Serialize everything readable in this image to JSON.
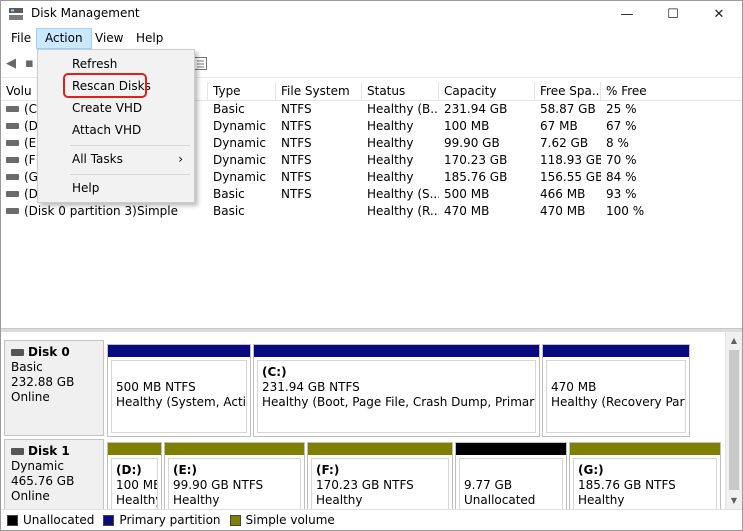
{
  "window": {
    "title": "Disk Management",
    "controls": {
      "minimize": "—",
      "maximize": "☐",
      "close": "✕"
    }
  },
  "menubar": [
    "File",
    "Action",
    "View",
    "Help"
  ],
  "action_menu": {
    "items": [
      "Refresh",
      "Rescan Disks",
      "Create VHD",
      "Attach VHD",
      "All Tasks",
      "Help"
    ],
    "submenu_arrow": "›",
    "highlighted": "Rescan Disks",
    "highlight_color": "#e0201a"
  },
  "volume_list": {
    "headers": [
      "Volu",
      "Type",
      "File System",
      "Status",
      "Capacity",
      "Free Spa...",
      "% Free"
    ],
    "rows": [
      {
        "volume": "(C",
        "layout": "",
        "type": "Basic",
        "fs": "NTFS",
        "status": "Healthy (B...",
        "capacity": "231.94 GB",
        "free": "58.87 GB",
        "pct": "25 %"
      },
      {
        "volume": "(D",
        "layout": "",
        "type": "Dynamic",
        "fs": "NTFS",
        "status": "Healthy",
        "capacity": "100 MB",
        "free": "67 MB",
        "pct": "67 %"
      },
      {
        "volume": "(E",
        "layout": "",
        "type": "Dynamic",
        "fs": "NTFS",
        "status": "Healthy",
        "capacity": "99.90 GB",
        "free": "7.62 GB",
        "pct": "8 %"
      },
      {
        "volume": "(F",
        "layout": "",
        "type": "Dynamic",
        "fs": "NTFS",
        "status": "Healthy",
        "capacity": "170.23 GB",
        "free": "118.93 GB",
        "pct": "70 %"
      },
      {
        "volume": "(G",
        "layout": "",
        "type": "Dynamic",
        "fs": "NTFS",
        "status": "Healthy",
        "capacity": "185.76 GB",
        "free": "156.55 GB",
        "pct": "84 %"
      },
      {
        "volume": "(Di",
        "layout": "",
        "type": "Basic",
        "fs": "NTFS",
        "status": "Healthy (S...",
        "capacity": "500 MB",
        "free": "466 MB",
        "pct": "93 %"
      },
      {
        "volume": "(Disk 0 partition 3)",
        "layout": "Simple",
        "type": "Basic",
        "fs": "",
        "status": "Healthy (R...",
        "capacity": "470 MB",
        "free": "470 MB",
        "pct": "100 %"
      }
    ]
  },
  "disks": [
    {
      "name": "Disk 0",
      "type": "Basic",
      "size": "232.88 GB",
      "state": "Online",
      "partitions": [
        {
          "label": "",
          "line1": "500 MB NTFS",
          "line2": "Healthy (System, Active,",
          "kind": "primary"
        },
        {
          "label": "(C:)",
          "line1": "231.94 GB NTFS",
          "line2": "Healthy (Boot, Page File, Crash Dump, Primary Partit",
          "kind": "primary"
        },
        {
          "label": "",
          "line1": "470 MB",
          "line2": "Healthy (Recovery Partiti",
          "kind": "primary"
        }
      ]
    },
    {
      "name": "Disk 1",
      "type": "Dynamic",
      "size": "465.76 GB",
      "state": "Online",
      "partitions": [
        {
          "label": "(D:)",
          "line1": "100 MB",
          "line2": "Healthy",
          "kind": "simple"
        },
        {
          "label": "(E:)",
          "line1": "99.90 GB NTFS",
          "line2": "Healthy",
          "kind": "simple"
        },
        {
          "label": "(F:)",
          "line1": "170.23 GB NTFS",
          "line2": "Healthy",
          "kind": "simple"
        },
        {
          "label": "",
          "line1": "9.77 GB",
          "line2": "Unallocated",
          "kind": "unallocated"
        },
        {
          "label": "(G:)",
          "line1": "185.76 GB NTFS",
          "line2": "Healthy",
          "kind": "simple"
        }
      ]
    }
  ],
  "legend": [
    {
      "label": "Unallocated",
      "color": "#000000"
    },
    {
      "label": "Primary partition",
      "color": "#0a0a80"
    },
    {
      "label": "Simple volume",
      "color": "#808000"
    }
  ],
  "colors": {
    "primary": "#0a0a80",
    "simple": "#808000",
    "unallocated": "#000000",
    "menu_active_bg": "#cce8ff"
  }
}
